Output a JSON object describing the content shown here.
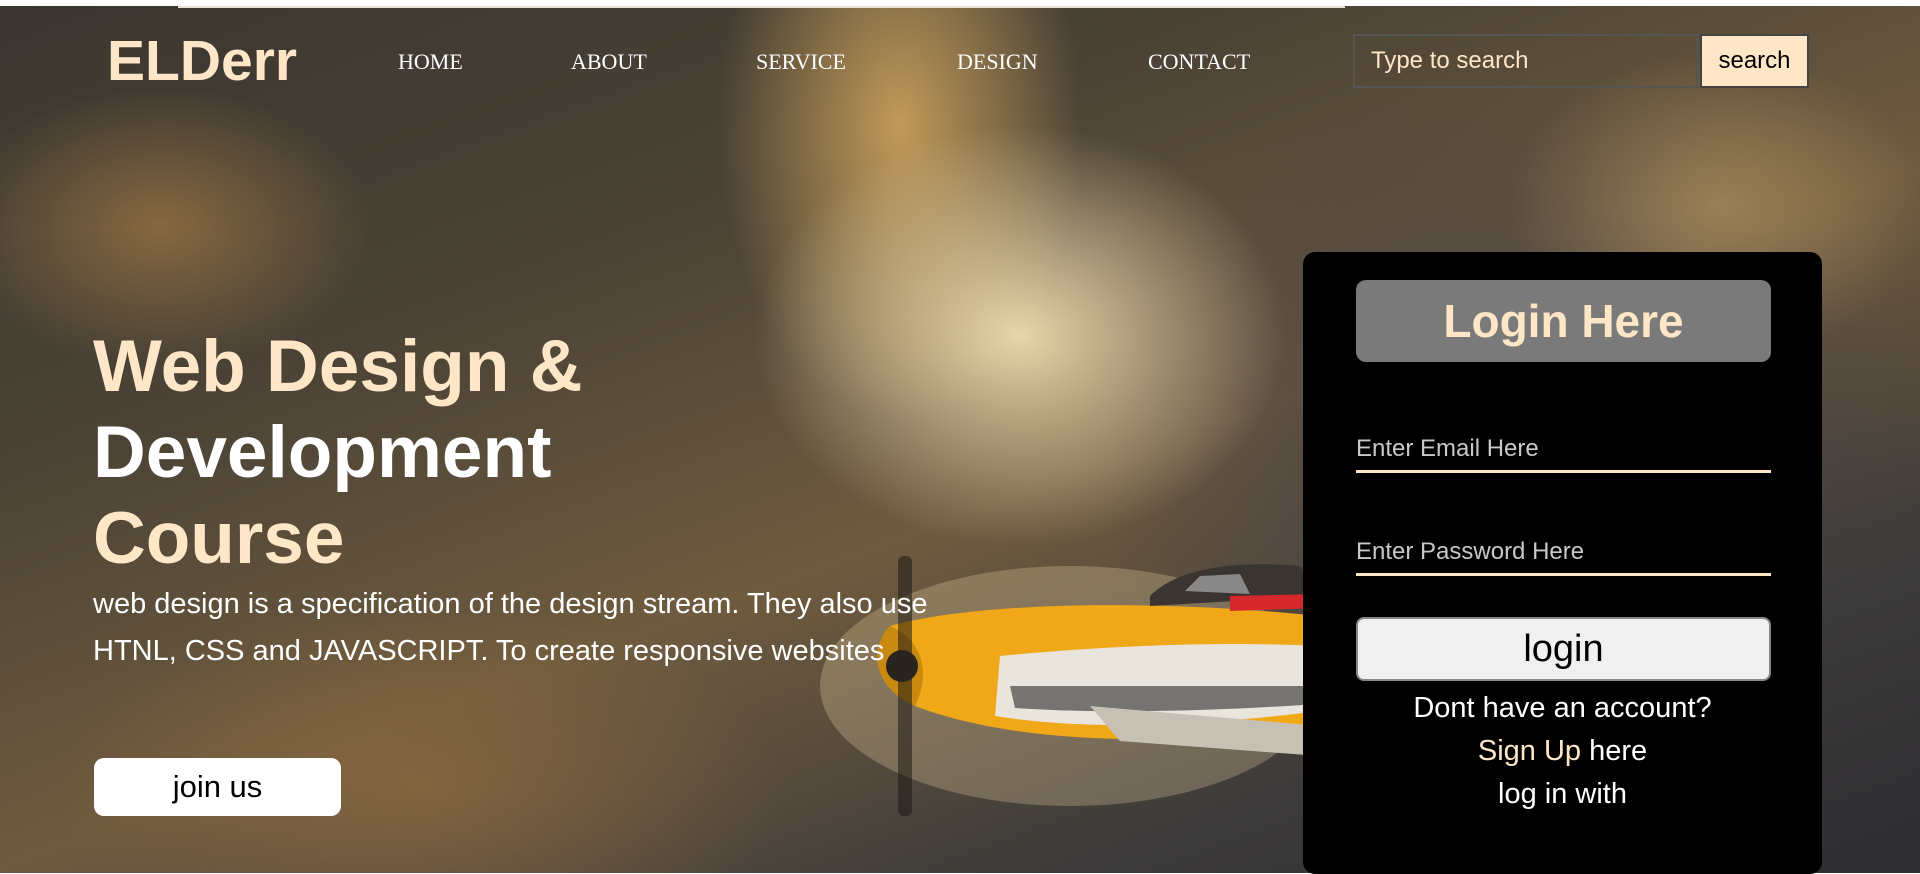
{
  "brand": {
    "logo": "ELDerr",
    "accent_color": "#ffe6c7",
    "panel_color": "#000000"
  },
  "nav": {
    "items": [
      {
        "label": "HOME"
      },
      {
        "label": "ABOUT"
      },
      {
        "label": "SERVICE"
      },
      {
        "label": "DESIGN"
      },
      {
        "label": "CONTACT"
      }
    ]
  },
  "search": {
    "placeholder": "Type to search",
    "button_label": "search"
  },
  "hero": {
    "headline_line1": "Web Design &",
    "headline_line2": "Development",
    "headline_line3": "Course",
    "description": "web design is a specification of the design stream. They also use HTNL, CSS and JAVASCRIPT. To create responsive websites",
    "join_label": "join us",
    "background_icon": "airplane-in-clouds-image"
  },
  "login": {
    "title": "Login Here",
    "email_placeholder": "Enter Email Here",
    "password_placeholder": "Enter Password Here",
    "button_label": "login",
    "no_account_text": "Dont have an account?",
    "signup_link": "Sign Up",
    "signup_suffix": " here",
    "login_with_text": "log in with"
  }
}
